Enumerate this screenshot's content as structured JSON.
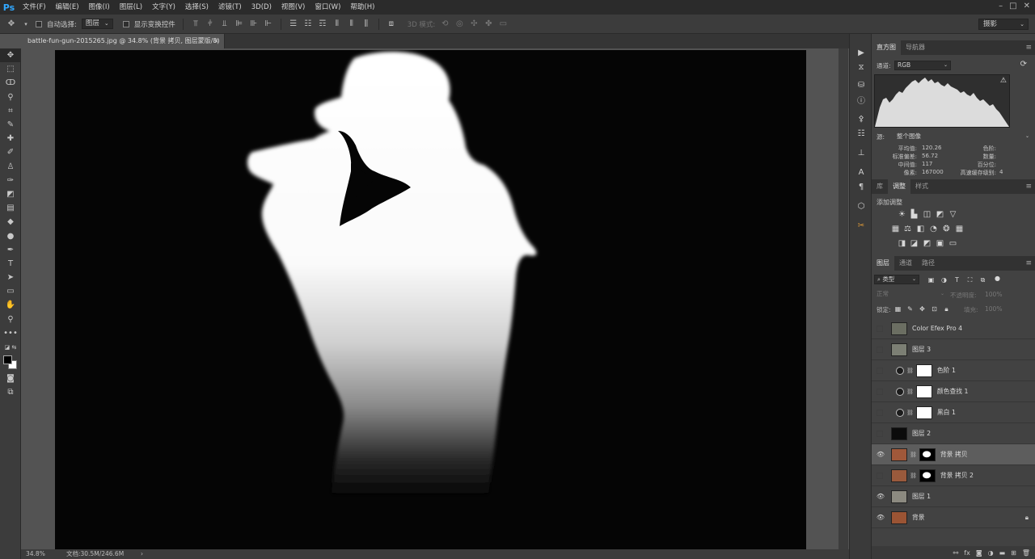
{
  "app": {
    "logo": "Ps"
  },
  "menu": [
    "文件(F)",
    "编辑(E)",
    "图像(I)",
    "图层(L)",
    "文字(Y)",
    "选择(S)",
    "滤镜(T)",
    "3D(D)",
    "视图(V)",
    "窗口(W)",
    "帮助(H)"
  ],
  "window_controls": [
    "–",
    "□",
    "✕"
  ],
  "options_bar": {
    "auto_select_label": "自动选择:",
    "auto_select_value": "图层",
    "show_transform_label": "显示变换控件",
    "mode_3d_label": "3D 模式:",
    "workspace": "摄影"
  },
  "document": {
    "tab_title": "battle-fun-gun-2015265.jpg @ 34.8% (背景 拷贝, 图层蒙版/8) *",
    "close": "×"
  },
  "status": {
    "zoom": "34.8%",
    "doc_size": "文档:30.5M/246.6M",
    "arrow": "›"
  },
  "histogram_panel": {
    "tabs": [
      "直方图",
      "导航器"
    ],
    "channel_label": "通道:",
    "channel_value": "RGB",
    "source_label": "源:",
    "source_value": "整个图像",
    "stats_left": [
      {
        "label": "平均值:",
        "value": "120.26"
      },
      {
        "label": "标准偏差:",
        "value": "56.72"
      },
      {
        "label": "中间值:",
        "value": "117"
      },
      {
        "label": "像素:",
        "value": "167000"
      }
    ],
    "stats_right": [
      {
        "label": "色阶:",
        "value": ""
      },
      {
        "label": "数量:",
        "value": ""
      },
      {
        "label": "百分位:",
        "value": ""
      },
      {
        "label": "高速缓存级别:",
        "value": "4"
      }
    ]
  },
  "adjustments_panel": {
    "tabs": [
      "库",
      "调整",
      "样式"
    ],
    "add_label": "添加调整"
  },
  "layers_panel": {
    "tabs": [
      "图层",
      "通道",
      "路径"
    ],
    "filter_kind": "类型",
    "blend_mode": "正常",
    "opacity_label": "不透明度:",
    "opacity_value": "100%",
    "lock_label": "锁定:",
    "fill_label": "填充:",
    "fill_value": "100%",
    "layers": [
      {
        "name": "Color Efex Pro 4",
        "visible": false,
        "type": "pixel",
        "thumb": "#6b6e62"
      },
      {
        "name": "图层 3",
        "visible": false,
        "type": "pixel",
        "thumb": "#7c7f74"
      },
      {
        "name": "色阶 1",
        "visible": false,
        "type": "adjustment"
      },
      {
        "name": "颜色查找 1",
        "visible": false,
        "type": "adjustment"
      },
      {
        "name": "黑白 1",
        "visible": false,
        "type": "adjustment"
      },
      {
        "name": "图层 2",
        "visible": false,
        "type": "pixel",
        "thumb": "#0b0b0b"
      },
      {
        "name": "背景 拷贝",
        "visible": true,
        "type": "masked",
        "thumb": "#a0583a",
        "selected": true
      },
      {
        "name": "背景 拷贝 2",
        "visible": false,
        "type": "masked",
        "thumb": "#9a5a3c"
      },
      {
        "name": "图层 1",
        "visible": true,
        "type": "pixel",
        "thumb": "#8c8a80"
      },
      {
        "name": "背景",
        "visible": true,
        "type": "pixel",
        "thumb": "#9b5434",
        "locked": true
      }
    ]
  },
  "colors": {
    "canvas_bg": "#050505",
    "silhouette": "#ffffff",
    "selected_layer": "#5d5d5d",
    "ps_blue": "#31a8ff"
  }
}
